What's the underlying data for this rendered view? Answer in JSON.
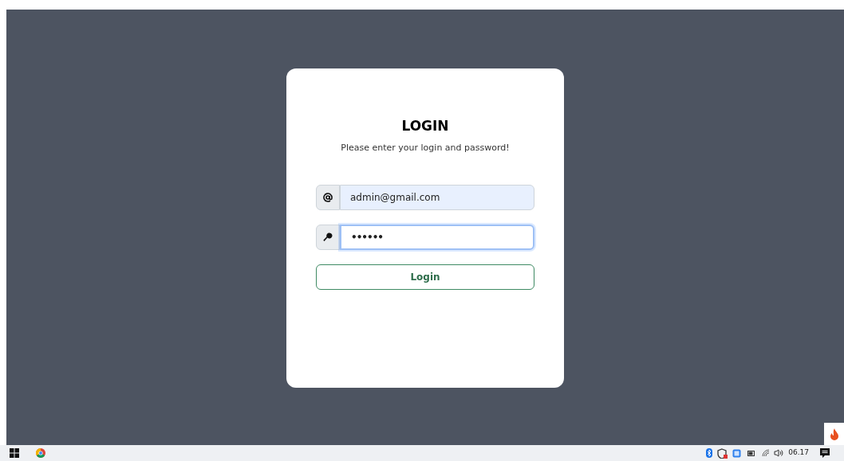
{
  "login": {
    "title": "LOGIN",
    "subtitle": "Please enter your login and password!",
    "fields": [
      {
        "kind": "email",
        "value": "admin@gmail.com",
        "focused": false,
        "autofilled": true
      },
      {
        "kind": "password",
        "value": "••••••",
        "focused": true,
        "autofilled": false
      }
    ],
    "button": "Login"
  },
  "taskbar": {
    "clock": "06.17"
  }
}
